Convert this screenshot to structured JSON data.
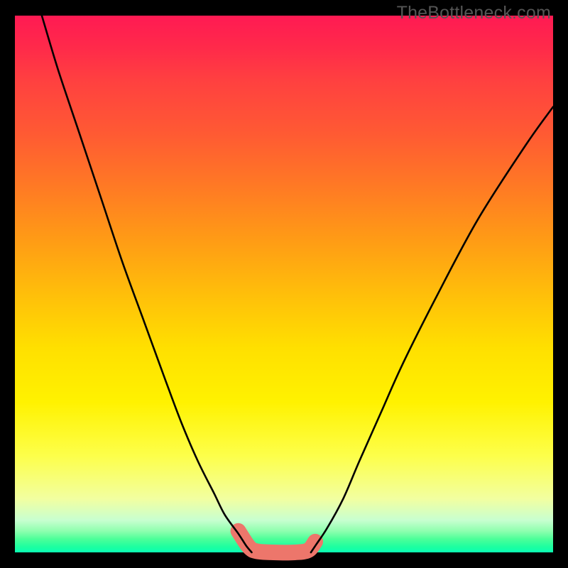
{
  "attribution": "TheBottleneck.com",
  "colors": {
    "frame": "#000000",
    "curve_stroke": "#000000",
    "marker_stroke": "#ed766b",
    "gradient_stops": [
      "#ff1a53",
      "#ff9c15",
      "#fff200",
      "#0affb4"
    ]
  },
  "chart_data": {
    "type": "line",
    "title": "",
    "xlabel": "",
    "ylabel": "",
    "xlim": [
      0,
      100
    ],
    "ylim": [
      0,
      100
    ],
    "grid": false,
    "legend": false,
    "series": [
      {
        "name": "left-curve",
        "x": [
          5,
          8,
          12,
          16,
          20,
          24,
          28,
          31,
          34,
          37,
          39,
          41.5,
          43,
          44
        ],
        "y": [
          100,
          90,
          78,
          66,
          54,
          43,
          32,
          24,
          17,
          11,
          7,
          3.5,
          1.2,
          0
        ]
      },
      {
        "name": "right-curve",
        "x": [
          55,
          56,
          58,
          61,
          64,
          68,
          72,
          78,
          86,
          95,
          100
        ],
        "y": [
          0,
          1.5,
          4.5,
          10,
          17,
          26,
          35,
          47,
          62,
          76,
          83
        ]
      },
      {
        "name": "floor-segment",
        "x": [
          44,
          55
        ],
        "y": [
          0,
          0
        ]
      }
    ],
    "markers": [
      {
        "name": "salmon-highlight",
        "x": [
          41.5,
          43.5,
          45,
          48,
          52,
          54.5,
          55.8
        ],
        "y": [
          4,
          1,
          0.2,
          0,
          0,
          0.4,
          2
        ]
      }
    ]
  }
}
